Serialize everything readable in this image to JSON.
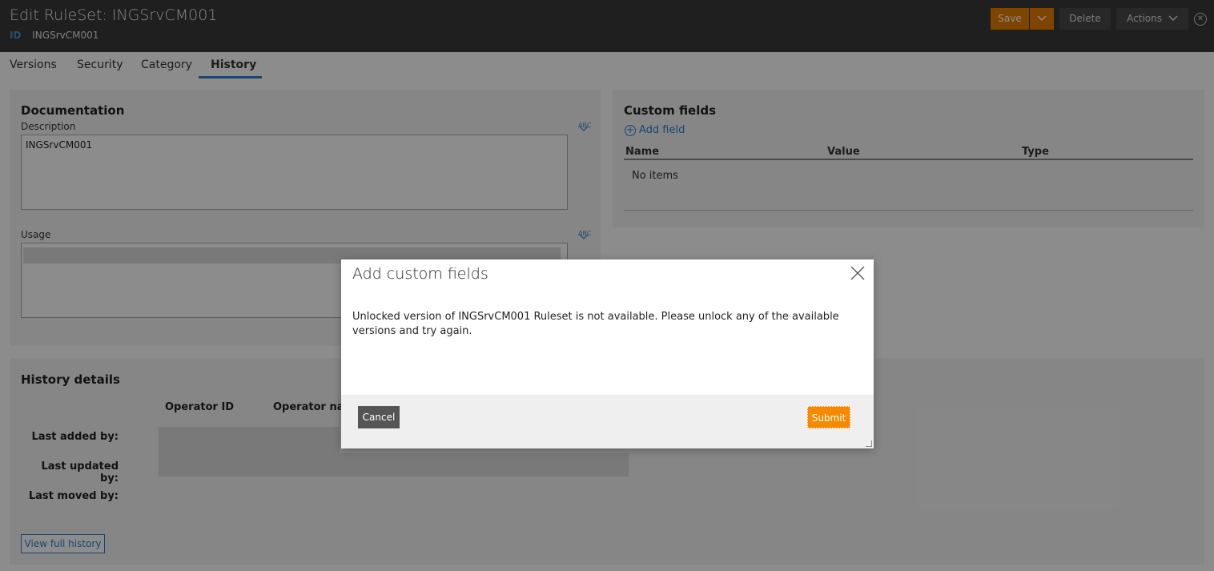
{
  "header": {
    "title": "Edit RuleSet: INGSrvCM001",
    "id_tag": "ID",
    "id_value": "INGSrvCM001",
    "save_label": "Save",
    "delete_label": "Delete",
    "actions_label": "Actions"
  },
  "tabs": [
    {
      "label": "Versions"
    },
    {
      "label": "Security"
    },
    {
      "label": "Category"
    },
    {
      "label": "History"
    }
  ],
  "documentation": {
    "heading": "Documentation",
    "description_label": "Description",
    "description_value": "INGSrvCM001",
    "usage_label": "Usage",
    "spellcheck_text": "ABC"
  },
  "custom_fields": {
    "heading": "Custom fields",
    "add_field_label": "Add field",
    "columns": [
      "Name",
      "Value",
      "Type"
    ],
    "empty_text": "No items"
  },
  "history": {
    "heading": "History details",
    "columns": [
      "Operator ID",
      "Operator nam"
    ],
    "rows": [
      "Last added by:",
      "Last updated by:",
      "Last moved by:"
    ],
    "view_full_history_label": "View full history"
  },
  "modal": {
    "title": "Add custom fields",
    "message": "Unlocked version of INGSrvCM001 Ruleset is not available. Please unlock any of the available versions and try again.",
    "cancel_label": "Cancel",
    "submit_label": "Submit"
  },
  "colors": {
    "header_bg": "#3a3a3a",
    "accent_orange": "#e67e00",
    "link_blue": "#2f7fd0"
  }
}
